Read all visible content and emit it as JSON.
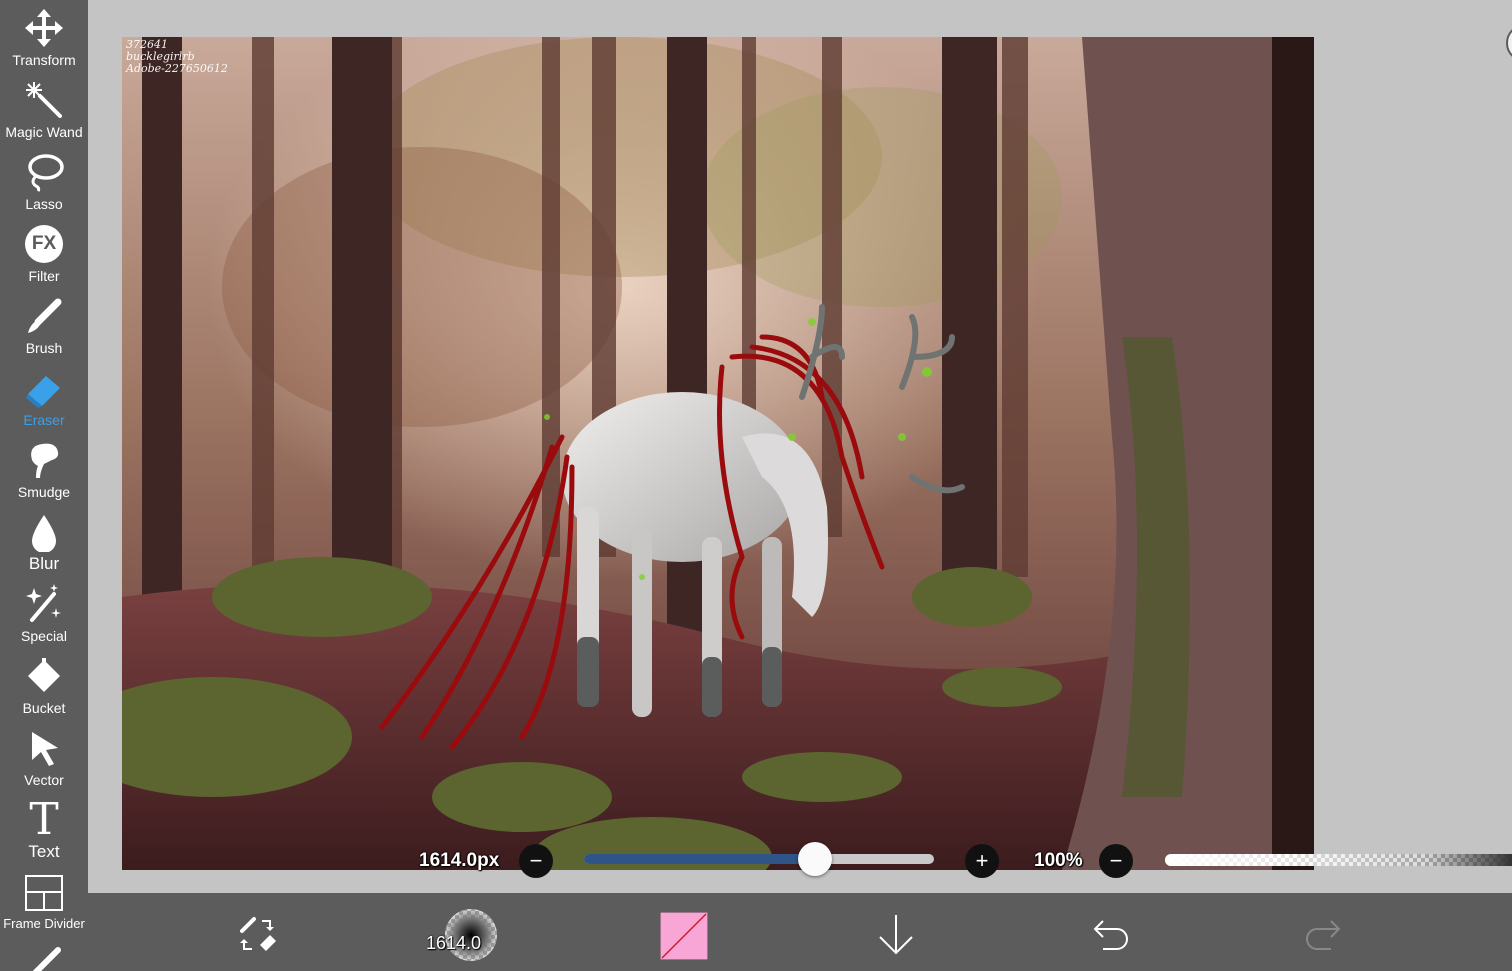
{
  "tools": [
    {
      "label": "Transform",
      "icon": "move-arrows-icon",
      "active": false
    },
    {
      "label": "Magic Wand",
      "icon": "magic-wand-icon",
      "active": false
    },
    {
      "label": "Lasso",
      "icon": "lasso-icon",
      "active": false
    },
    {
      "label": "Filter",
      "icon": "fx-icon",
      "active": false
    },
    {
      "label": "Brush",
      "icon": "brush-icon",
      "active": false
    },
    {
      "label": "Eraser",
      "icon": "eraser-icon",
      "active": true
    },
    {
      "label": "Smudge",
      "icon": "smudge-icon",
      "active": false
    },
    {
      "label": "Blur",
      "icon": "blur-drop-icon",
      "active": false
    },
    {
      "label": "Special",
      "icon": "sparkle-wand-icon",
      "active": false
    },
    {
      "label": "Bucket",
      "icon": "bucket-icon",
      "active": false
    },
    {
      "label": "Vector",
      "icon": "vector-cursor-icon",
      "active": false
    },
    {
      "label": "Text",
      "icon": "text-icon",
      "active": false
    },
    {
      "label": "Frame Divider",
      "icon": "frame-divider-icon",
      "active": false
    }
  ],
  "filter_icon_text": "FX",
  "text_icon_glyph": "T",
  "watermark": [
    "372641",
    "bucklegirlrb",
    "Adobe-227650612"
  ],
  "brush": {
    "size_label": "1614.0px",
    "size_fraction": 0.66,
    "opacity_label": "100%",
    "preview_label": "1614.0"
  },
  "buttons": {
    "minus": "−",
    "plus": "+"
  },
  "colors": {
    "sidebar": "#5c5c5c",
    "active_tool": "#3aa0e8",
    "slider_fill": "#2f5488",
    "current_color": "#f7a6d6"
  }
}
